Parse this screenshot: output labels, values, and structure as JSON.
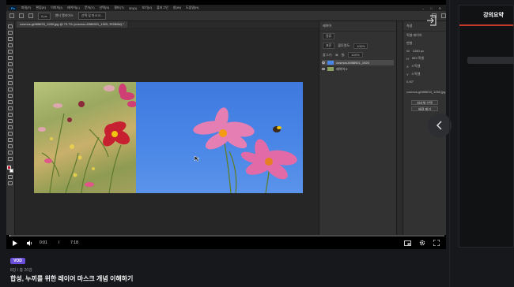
{
  "photoshop": {
    "menu": [
      "파일(F)",
      "편집(E)",
      "이미지(I)",
      "레이어(L)",
      "문자(Y)",
      "선택(S)",
      "필터(T)",
      "3D(D)",
      "보기(V)",
      "플러그인",
      "창(W)",
      "도움말(H)"
    ],
    "options": {
      "width_value": "0 px",
      "anti_alias": "앤티 앨리어스",
      "select_mask": "선택 및 마스크..."
    },
    "doc_tab": "cosmos-gf48f6f33_1280.jpg @ 73.7% (cosmos-6988921_1920, RGB/8#) *",
    "layers_panel": {
      "title": "레이어",
      "kind": "종류",
      "blend_mode": "표준",
      "opacity_label": "불투명도:",
      "opacity_value": "100%",
      "lock_label": "잠그기:",
      "fill_label": "칠:",
      "fill_value": "100%",
      "layers": [
        {
          "name": "cosmos-6988921_1920",
          "selected": true
        },
        {
          "name": "레이어 0",
          "selected": false
        }
      ]
    },
    "properties_panel": {
      "title": "속성",
      "subtitle": "픽셀 레이어",
      "section": "변형",
      "w_label": "W",
      "w_value": "1280 px",
      "h_label": "H",
      "h_value": "853 픽셀",
      "x_label": "X",
      "x_value": "0 픽셀",
      "y_label": "Y",
      "y_value": "0 픽셀",
      "angle_value": "0.00°",
      "doc_name": "cosmos-gf48f6f33_1280.jpg",
      "buttons": [
        "피사체 선택",
        "배경 제거"
      ]
    }
  },
  "player": {
    "current_time": "0:01",
    "total_time": "7:18",
    "progress_fraction": 0.002
  },
  "side_panel": {
    "title": "강의요약"
  },
  "lesson": {
    "badge": "VOD",
    "meta": "8강 / 총 20강",
    "title": "합성, 누끼를 위한 레이어 마스크 개념 이해하기"
  },
  "colors": {
    "accent_purple": "#6a4dd8",
    "panel_underline": "#c0392b",
    "ps_blue_sky": "#4a86e6"
  }
}
